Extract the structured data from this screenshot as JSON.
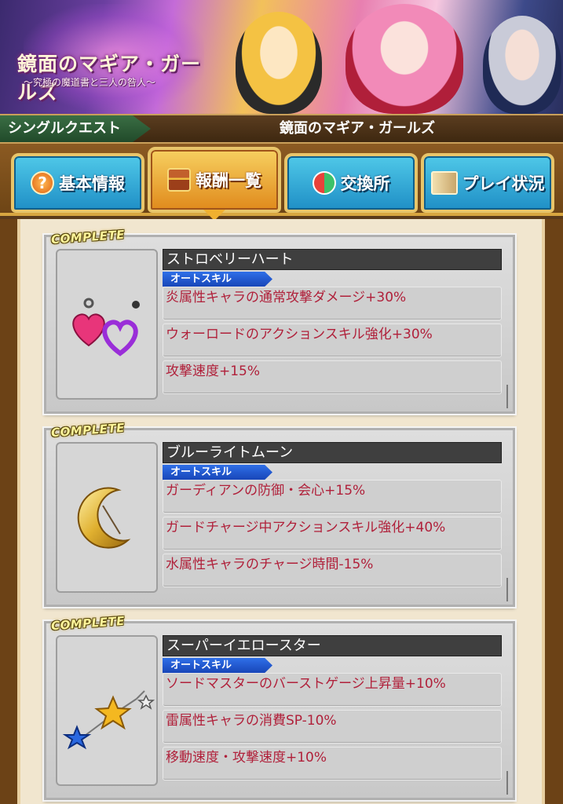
{
  "banner": {
    "title": "鏡面のマギア・ガールズ",
    "subtitle": "〜究極の魔道書と三人の咎人〜"
  },
  "quest_bar": {
    "type": "シングルクエスト",
    "name": "鏡面のマギア・ガールズ"
  },
  "tabs": [
    {
      "label": "基本情報",
      "icon": "question-icon",
      "active": false
    },
    {
      "label": "報酬一覧",
      "icon": "treasure-chest-icon",
      "active": true
    },
    {
      "label": "交換所",
      "icon": "exchange-icon",
      "active": false
    },
    {
      "label": "プレイ状況",
      "icon": "scroll-icon",
      "active": false
    }
  ],
  "rewards": [
    {
      "badge": "COMPLETE",
      "item_icon": "heart-earrings-icon",
      "name": "ストロベリーハート",
      "skill_type": "オートスキル",
      "effects": [
        "炎属性キャラの通常攻撃ダメージ+30%",
        "ウォーロードのアクションスキル強化+30%",
        "攻撃速度+15%"
      ]
    },
    {
      "badge": "COMPLETE",
      "item_icon": "crescent-moon-icon",
      "name": "ブルーライトムーン",
      "skill_type": "オートスキル",
      "effects": [
        "ガーディアンの防御・会心+15%",
        "ガードチャージ中アクションスキル強化+40%",
        "水属性キャラのチャージ時間-15%"
      ]
    },
    {
      "badge": "COMPLETE",
      "item_icon": "star-charm-icon",
      "name": "スーパーイエロースター",
      "skill_type": "オートスキル",
      "effects": [
        "ソードマスターのバーストゲージ上昇量+10%",
        "雷属性キャラの消費SP-10%",
        "移動速度・攻撃速度+10%"
      ]
    }
  ]
}
